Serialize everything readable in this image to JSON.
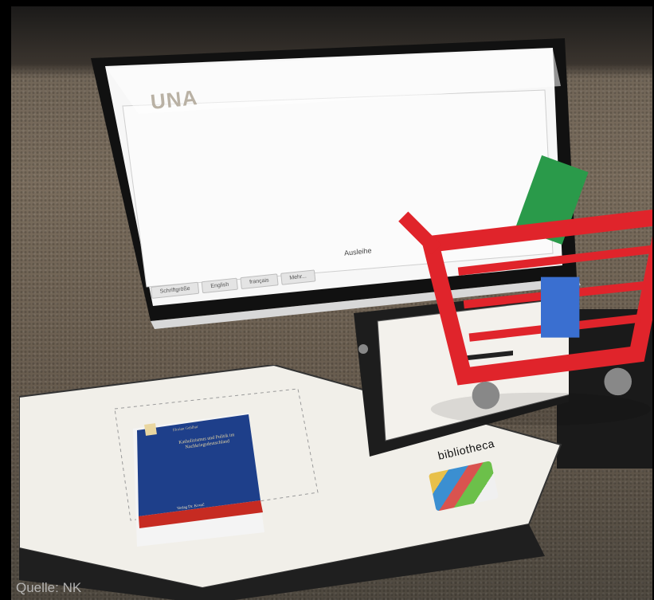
{
  "kiosk": {
    "logo": "UNA",
    "main_action_label": "Ausleihe",
    "footer_tabs": [
      "Schriftgröße",
      "English",
      "français",
      "Mehr..."
    ]
  },
  "book": {
    "author": "Florian Gehlhar",
    "title": "Katholizismus und Politik im Nachkriegsdeutschland",
    "publisher": "Verlag Dr. Kovač"
  },
  "brand_label": "bibliotheca",
  "caption": "Quelle: NK",
  "colors": {
    "cart_red": "#e0242b",
    "book_blue": "#1e3f8a",
    "book_red": "#c62b22"
  }
}
